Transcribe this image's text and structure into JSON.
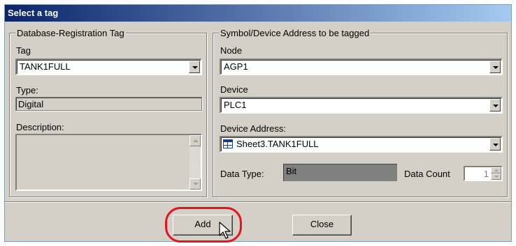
{
  "window": {
    "title": "Select a tag"
  },
  "db_group": {
    "legend": "Database-Registration Tag",
    "tag_label": "Tag",
    "tag_value": "TANK1FULL",
    "type_label": "Type:",
    "type_value": "Digital",
    "description_label": "Description:",
    "description_value": ""
  },
  "symbol_group": {
    "legend": "Symbol/Device Address to be tagged",
    "node_label": "Node",
    "node_value": "AGP1",
    "device_label": "Device",
    "device_value": "PLC1",
    "address_label": "Device Address:",
    "address_value": "Sheet3.TANK1FULL",
    "data_type_label": "Data Type:",
    "data_type_value": "Bit",
    "data_count_label": "Data Count",
    "data_count_value": "1"
  },
  "buttons": {
    "add": "Add",
    "close": "Close"
  },
  "colors": {
    "highlight": "#e3141b",
    "title_start": "#0a246a",
    "title_end": "#a6caf0",
    "face": "#d4d0c8"
  }
}
